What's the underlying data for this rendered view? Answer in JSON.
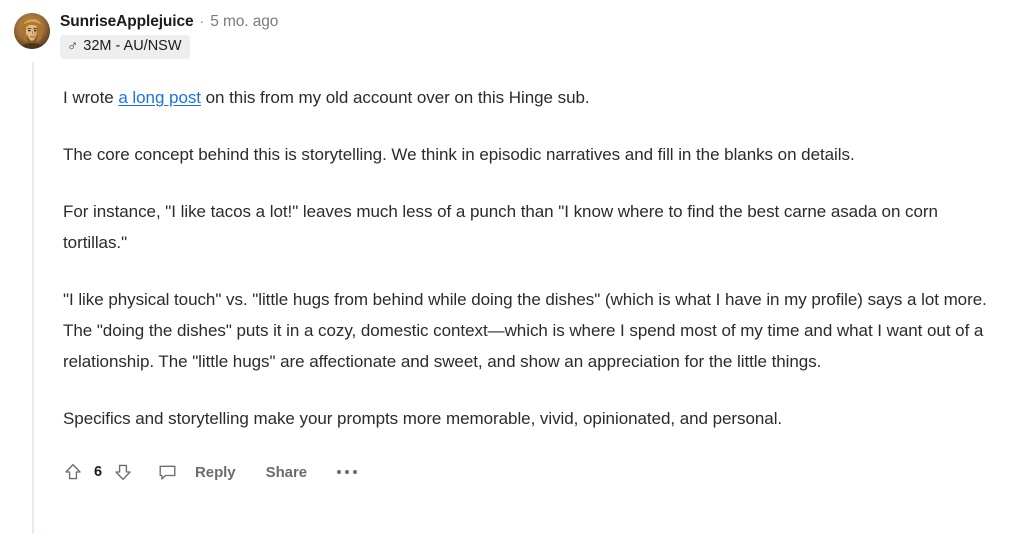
{
  "comment": {
    "author": {
      "username": "SunriseApplejuice",
      "avatar_icon": "user-avatar-portrait",
      "avatar_bg_color": "#8c6239"
    },
    "separator": "·",
    "timestamp": "5 mo. ago",
    "flair": {
      "gender_icon": "male-symbol",
      "gender_glyph": "♂",
      "label": "32M - AU/NSW",
      "bg_color": "#eceef0"
    },
    "body": {
      "p1_before_link": "I wrote ",
      "p1_link_text": "a long post",
      "p1_after_link": " on this from my old account over on this Hinge sub.",
      "p2": "The core concept behind this is storytelling. We think in episodic narratives and fill in the blanks on details.",
      "p3": "For instance, \"I like tacos a lot!\" leaves much less of a punch than \"I know where to find the best carne asada on corn tortillas.\"",
      "p4": "\"I like physical touch\" vs. \"little hugs from behind while doing the dishes\" (which is what I have in my profile) says a lot more. The \"doing the dishes\" puts it in a cozy, domestic context—which is where I spend most of my time and what I want out of a relationship. The \"little hugs\" are affectionate and sweet, and show an appreciation for the little things.",
      "p5": "Specifics and storytelling make your prompts more memorable, vivid, opinionated, and personal."
    },
    "link_color": "#1a73e8",
    "actions": {
      "upvote_icon": "upvote-arrow-icon",
      "score": "6",
      "downvote_icon": "downvote-arrow-icon",
      "comment_icon": "comment-bubble-icon",
      "reply_label": "Reply",
      "share_label": "Share",
      "more_icon": "more-options-icon"
    }
  }
}
